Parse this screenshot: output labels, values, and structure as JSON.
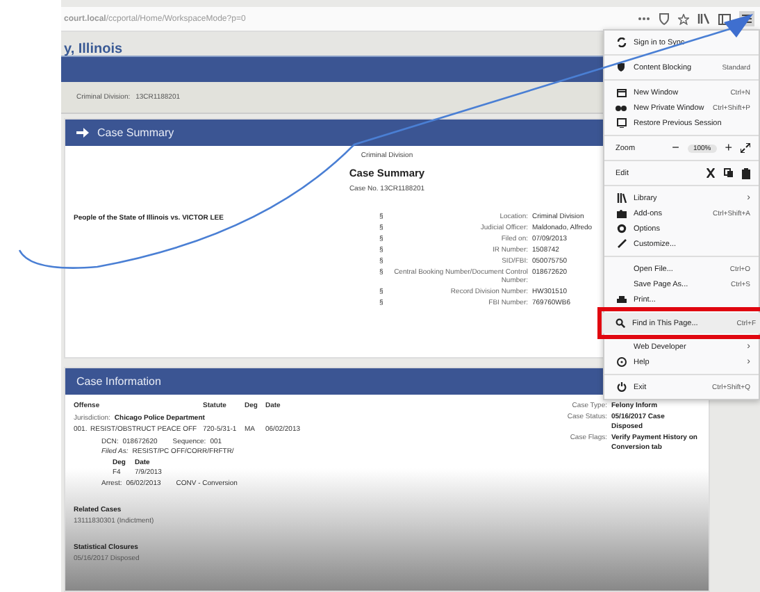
{
  "browser": {
    "url": "**court.local**/ccportal/Home/WorkspaceMode?p=0"
  },
  "site": {
    "title": "y, Illinois"
  },
  "breadcrumb": {
    "label": "Criminal Division:",
    "value": "13CR1188201"
  },
  "case_summary": {
    "header": "Case Summary",
    "division": "Criminal Division",
    "title": "Case Summary",
    "case_no": "Case No. 13CR1188201",
    "parties": "People of the State of Illinois vs. VICTOR LEE",
    "details": [
      {
        "marker": "§",
        "label": "Location:",
        "value": "Criminal Division"
      },
      {
        "marker": "§",
        "label": "Judicial Officer:",
        "value": "Maldonado, Alfredo"
      },
      {
        "marker": "§",
        "label": "Filed on:",
        "value": "07/09/2013"
      },
      {
        "marker": "§",
        "label": "IR Number:",
        "value": "1508742"
      },
      {
        "marker": "§",
        "label": "SID/FBI:",
        "value": "050075750"
      },
      {
        "marker": "§",
        "label": "Central Booking Number/Document Control Number:",
        "value": "018672620"
      },
      {
        "marker": "§",
        "label": "Record Division Number:",
        "value": "HW301510"
      },
      {
        "marker": "§",
        "label": "FBI Number:",
        "value": "769760WB6"
      }
    ]
  },
  "case_information": {
    "header": "Case Information",
    "columns": [
      "Offense",
      "Statute",
      "Deg",
      "Date"
    ],
    "jurisdiction": {
      "label": "Jurisdiction:",
      "value": "Chicago Police Department"
    },
    "offense": {
      "number": "001.",
      "name": "RESIST/OBSTRUCT PEACE OFF",
      "statute": "720-5/31-1",
      "deg": "MA",
      "date": "06/02/2013"
    },
    "dcn": {
      "label": "DCN:",
      "value": "018672620",
      "seq_label": "Sequence:",
      "seq_value": "001"
    },
    "filed_as": {
      "label": "Filed As:",
      "value": "RESIST/PC OFF/CORR/FRFTR/"
    },
    "deg_columns": [
      "Deg",
      "Date"
    ],
    "deg_row": [
      "F4",
      "7/9/2013"
    ],
    "arrest": {
      "label": "Arrest:",
      "date": "06/02/2013",
      "type": "CONV - Conversion"
    },
    "facts": [
      {
        "label": "Case Type:",
        "value": "Felony Inform"
      },
      {
        "label": "Case Status:",
        "value": "05/16/2017  Case Disposed"
      },
      {
        "label": "Case Flags:",
        "value": "Verify Payment History on Conversion tab"
      }
    ],
    "related_title": "Related Cases",
    "related_value": "13111830301 (Indictment)",
    "closures_title": "Statistical Closures",
    "closures_value": "05/16/2017  Disposed"
  },
  "menu": {
    "items": [
      {
        "kind": "item",
        "label": "Sign in to Sync",
        "highlighted": false
      },
      {
        "kind": "separator"
      },
      {
        "kind": "item",
        "label": "Content Blocking",
        "shortcut": "Standard",
        "highlighted": false
      },
      {
        "kind": "separator"
      },
      {
        "kind": "item",
        "label": "New Window",
        "shortcut": "Ctrl+N",
        "highlighted": false
      },
      {
        "kind": "item",
        "label": "New Private Window",
        "shortcut": "Ctrl+Shift+P",
        "highlighted": false
      },
      {
        "kind": "item",
        "label": "Restore Previous Session",
        "highlighted": false
      },
      {
        "kind": "separator"
      },
      {
        "kind": "zoom",
        "label": "Zoom",
        "minus": "−",
        "value": "100%",
        "plus": "+"
      },
      {
        "kind": "separator"
      },
      {
        "kind": "edit",
        "label": "Edit"
      },
      {
        "kind": "separator"
      },
      {
        "kind": "item",
        "label": "Library",
        "arrow": "›",
        "highlighted": false
      },
      {
        "kind": "item",
        "label": "Add-ons",
        "shortcut": "Ctrl+Shift+A",
        "highlighted": false
      },
      {
        "kind": "item",
        "label": "Options",
        "highlighted": false
      },
      {
        "kind": "item",
        "label": "Customize...",
        "highlighted": false
      },
      {
        "kind": "separator"
      },
      {
        "kind": "item",
        "label": "Open File...",
        "shortcut": "Ctrl+O",
        "highlighted": false
      },
      {
        "kind": "item",
        "label": "Save Page As...",
        "shortcut": "Ctrl+S",
        "highlighted": false
      },
      {
        "kind": "item",
        "label": "Print...",
        "highlighted": false
      },
      {
        "kind": "item",
        "label": "Find in This Page...",
        "shortcut": "Ctrl+F",
        "highlighted": true
      },
      {
        "kind": "item",
        "label": "Web Developer",
        "arrow": "›",
        "highlighted": false
      },
      {
        "kind": "item",
        "label": "Help",
        "arrow": "›",
        "highlighted": false
      },
      {
        "kind": "separator"
      },
      {
        "kind": "item",
        "label": "Exit",
        "shortcut": "Ctrl+Shift+Q",
        "highlighted": false
      }
    ]
  }
}
